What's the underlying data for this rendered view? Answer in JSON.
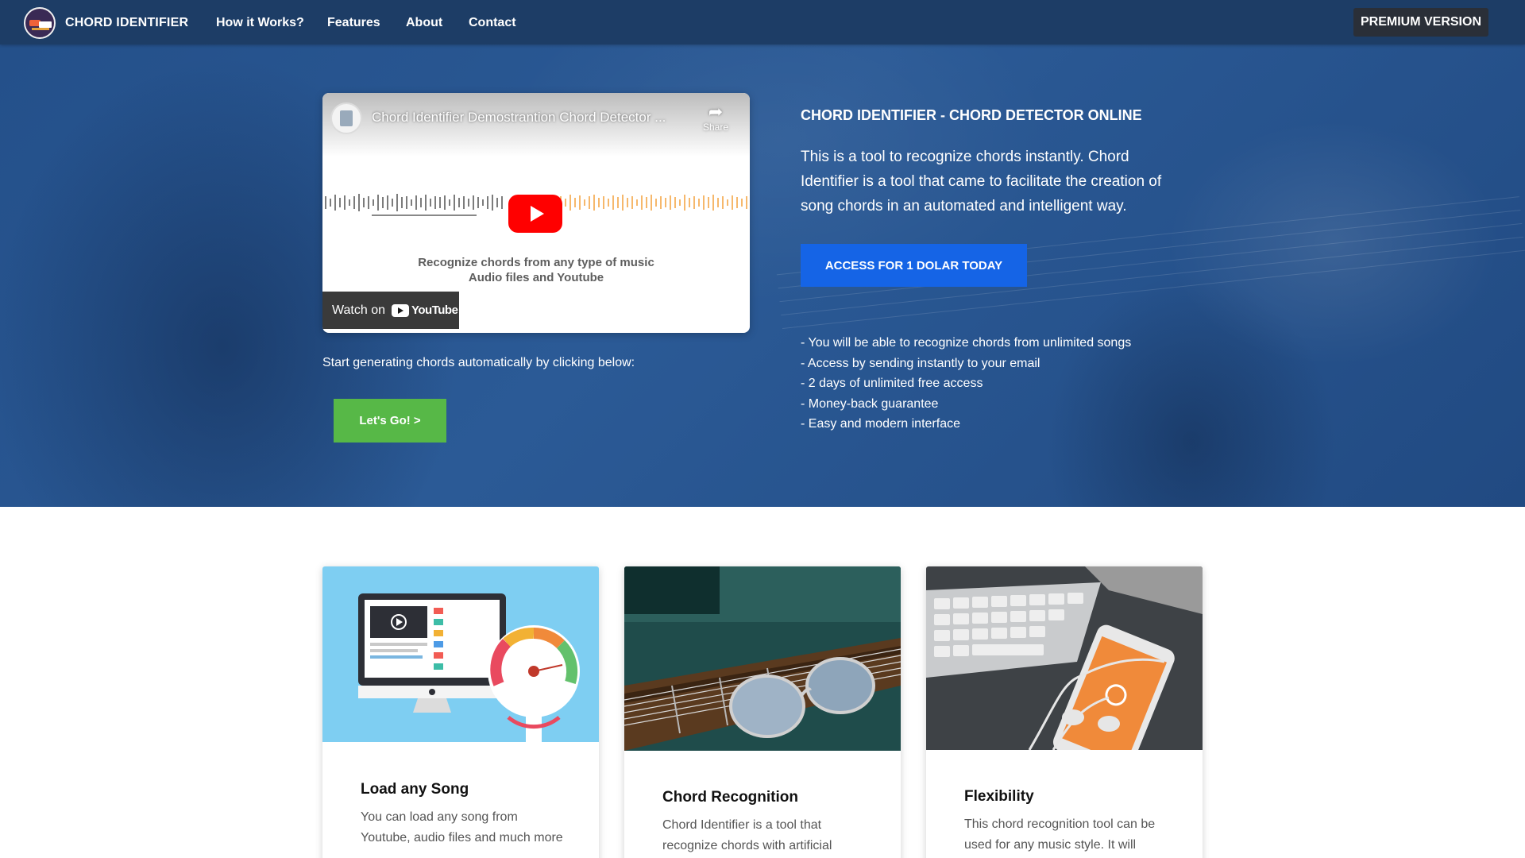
{
  "nav": {
    "brand": "CHORD IDENTIFIER",
    "links": [
      "How it Works?",
      "Features",
      "About",
      "Contact"
    ],
    "premium": "PREMIUM VERSION"
  },
  "video": {
    "title": "Chord Identifier Demostrantion Chord Detector ...",
    "share": "Share",
    "caption_line1": "Recognize chords from any type of music",
    "caption_line2": "Audio files and Youtube",
    "watch_on": "Watch on",
    "youtube": "YouTube"
  },
  "hero": {
    "start_text": "Start generating chords automatically by clicking below:",
    "lets_go": "Let's Go! >",
    "heading": "CHORD IDENTIFIER - CHORD DETECTOR ONLINE",
    "description": "This is a tool to recognize chords instantly. Chord Identifier is a tool that came to facilitate the creation of song chords in an automated and intelligent way.",
    "access_button": "ACCESS FOR 1 DOLAR TODAY",
    "benefits": [
      "- You will be able to recognize chords from unlimited songs",
      "- Access by sending instantly to your email",
      "- 2 days of unlimited free access",
      "- Money-back guarantee",
      "- Easy and modern interface"
    ]
  },
  "features": [
    {
      "title": "Load any Song",
      "text": "You can load any song from Youtube, audio files and much more"
    },
    {
      "title": "Chord Recognition",
      "text": "Chord Identifier is a tool that recognize chords with artificial"
    },
    {
      "title": "Flexibility",
      "text": "This chord recognition tool can be used for any music style. It will"
    }
  ],
  "colors": {
    "navbar": "#1d3d66",
    "hero": "#24508a",
    "access_button": "#1564e6",
    "lets_go_button": "#57b847",
    "premium_button": "#2a2f38",
    "youtube_red": "#ff0000"
  },
  "icons": [
    "logo-icon",
    "share-icon",
    "play-icon",
    "youtube-logo-icon"
  ]
}
